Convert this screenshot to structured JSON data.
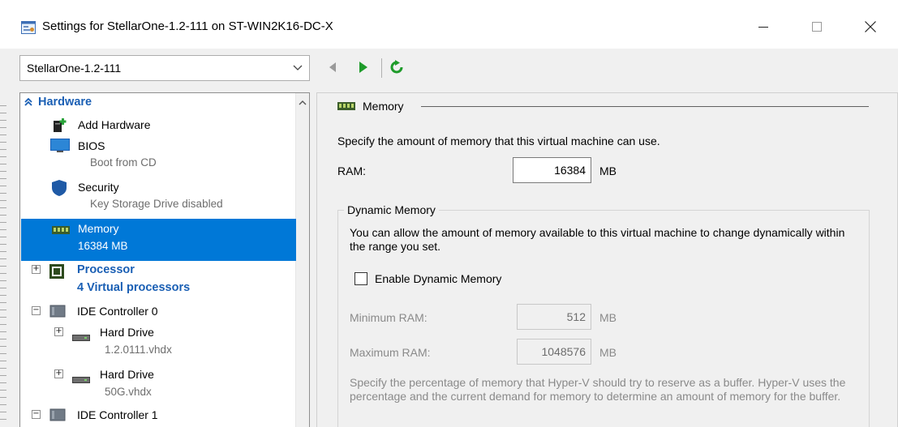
{
  "window": {
    "title": "Settings for StellarOne-1.2-111 on ST-WIN2K16-DC-X",
    "minimize_icon": "minimize-icon",
    "maximize_icon": "maximize-icon",
    "close_icon": "close-icon"
  },
  "vm_selector": {
    "value": "StellarOne-1.2-111"
  },
  "nav": {
    "back_icon": "back-arrow-icon",
    "forward_icon": "forward-arrow-icon",
    "refresh_icon": "refresh-icon",
    "forward_color": "#1e9b2a",
    "refresh_color": "#1e9b2a"
  },
  "tree": {
    "hardware_header": "Hardware",
    "items": [
      {
        "label": "Add Hardware",
        "sub": ""
      },
      {
        "label": "BIOS",
        "sub": "Boot from CD"
      },
      {
        "label": "Security",
        "sub": "Key Storage Drive disabled"
      },
      {
        "label": "Memory",
        "sub": "16384 MB",
        "selected": true
      },
      {
        "label": "Processor",
        "sub": "4 Virtual processors"
      },
      {
        "label": "IDE Controller 0",
        "sub": ""
      },
      {
        "label": "Hard Drive",
        "sub": "1.2.0111.vhdx"
      },
      {
        "label": "Hard Drive",
        "sub": "50G.vhdx"
      },
      {
        "label": "IDE Controller 1",
        "sub": ""
      }
    ]
  },
  "memory": {
    "section_title": "Memory",
    "description": "Specify the amount of memory that this virtual machine can use.",
    "ram_label": "RAM:",
    "ram_value": "16384",
    "ram_unit": "MB",
    "dynamic": {
      "legend": "Dynamic Memory",
      "description": "You can allow the amount of memory available to this virtual machine to change dynamically within the range you set.",
      "enable_label": "Enable Dynamic Memory",
      "enabled": false,
      "min_label": "Minimum RAM:",
      "min_value": "512",
      "min_unit": "MB",
      "max_label": "Maximum RAM:",
      "max_value": "1048576",
      "max_unit": "MB",
      "buffer_description": "Specify the percentage of memory that Hyper-V should try to reserve as a buffer. Hyper-V uses the percentage and the current demand for memory to determine an amount of memory for the buffer."
    }
  },
  "colors": {
    "selection": "#0078d7",
    "header_blue": "#1a5fb4",
    "disabled_text": "#8a8a8a"
  }
}
